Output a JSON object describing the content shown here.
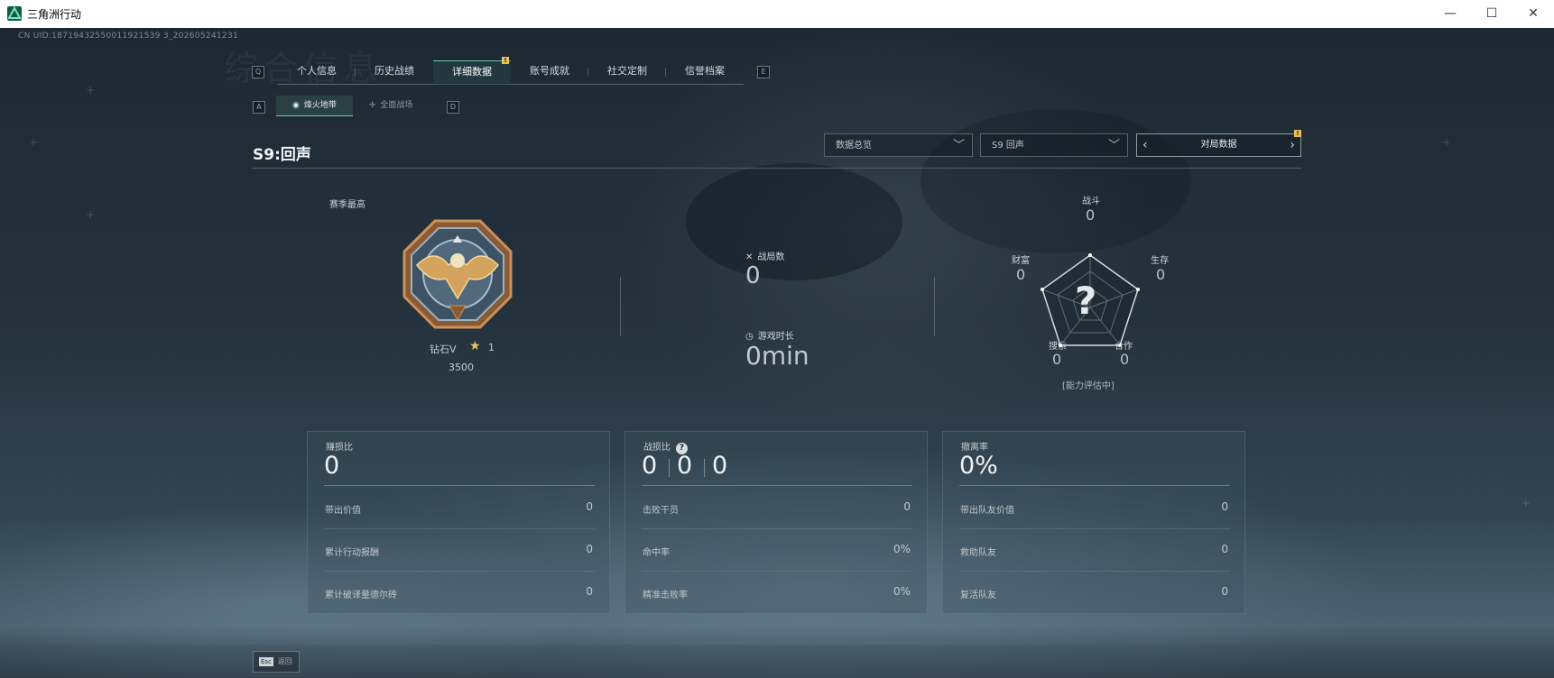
{
  "window": {
    "title": "三角洲行动",
    "min": "—",
    "max": "☐",
    "close": "✕"
  },
  "uid": "CN UID:18719432550011921539 3_202605241231",
  "watermark": "综合信息",
  "nav": {
    "left_key": "Q",
    "right_key": "E",
    "tabs": [
      "个人信息",
      "历史战绩",
      "详细数据",
      "账号成就",
      "社交定制",
      "信誉档案"
    ],
    "active_index": 2,
    "badge": "!"
  },
  "subnav": {
    "left_key": "A",
    "right_key": "D",
    "tabs": [
      {
        "label": "烽火地带",
        "icon": "eye-icon"
      },
      {
        "label": "全面战场",
        "icon": "crosshair-icon"
      }
    ],
    "active_index": 0
  },
  "season": "S9:回声",
  "dropdowns": {
    "overview": "数据总览",
    "season": "S9 回声",
    "pager": "对局数据",
    "pager_badge": "!"
  },
  "rank": {
    "label": "赛季最高",
    "name": "钻石V",
    "stars": "1",
    "score": "3500"
  },
  "stats": {
    "matches_label": "战局数",
    "matches_value": "0",
    "playtime_label": "游戏时长",
    "playtime_value": "0min"
  },
  "radar": {
    "combat_label": "战斗",
    "combat_value": "0",
    "survival_label": "生存",
    "survival_value": "0",
    "teamwork_label": "合作",
    "teamwork_value": "0",
    "search_label": "搜索",
    "search_value": "0",
    "wealth_label": "财富",
    "wealth_value": "0",
    "unknown_mark": "?",
    "note": "[能力评估中]"
  },
  "panels": {
    "profit": {
      "title": "赚损比",
      "value": "0",
      "rows": [
        {
          "k": "带出价值",
          "v": "0"
        },
        {
          "k": "累计行动报酬",
          "v": "0"
        },
        {
          "k": "累计破译量德尔砖",
          "v": "0"
        }
      ]
    },
    "kd": {
      "title": "战损比",
      "help": "?",
      "values": [
        "0",
        "0",
        "0"
      ],
      "rows": [
        {
          "k": "击败干员",
          "v": "0"
        },
        {
          "k": "命中率",
          "v": "0%"
        },
        {
          "k": "精准击败率",
          "v": "0%"
        }
      ]
    },
    "extract": {
      "title": "撤离率",
      "value": "0%",
      "rows": [
        {
          "k": "带出队友价值",
          "v": "0"
        },
        {
          "k": "救助队友",
          "v": "0"
        },
        {
          "k": "复活队友",
          "v": "0"
        }
      ]
    }
  },
  "bottom": {
    "esc_key": "Esc",
    "esc_label": "返回"
  }
}
